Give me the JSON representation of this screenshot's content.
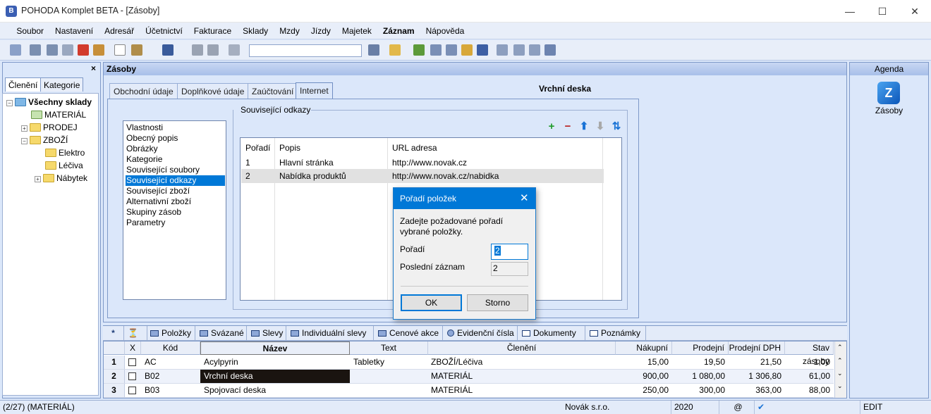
{
  "window": {
    "title": "POHODA Komplet BETA - [Zásoby]",
    "app_icon": "B",
    "minimize": "—",
    "maximize": "☐",
    "close": "✕"
  },
  "menu": [
    "Soubor",
    "Nastavení",
    "Adresář",
    "Účetnictví",
    "Fakturace",
    "Sklady",
    "Mzdy",
    "Jízdy",
    "Majetek",
    "Záznam",
    "Nápověda"
  ],
  "left_panel": {
    "tabs": [
      "Členění",
      "Kategorie"
    ],
    "close": "×",
    "tree": [
      {
        "label": "Všechny sklady",
        "level": 0,
        "bold": true,
        "expander": "−"
      },
      {
        "label": "MATERIÁL",
        "level": 1,
        "expander": ""
      },
      {
        "label": "PRODEJ",
        "level": 1,
        "expander": "+"
      },
      {
        "label": "ZBOŽÍ",
        "level": 1,
        "expander": "−"
      },
      {
        "label": "Elektro",
        "level": 2,
        "expander": ""
      },
      {
        "label": "Léčiva",
        "level": 2,
        "expander": ""
      },
      {
        "label": "Nábytek",
        "level": 2,
        "expander": "+"
      }
    ]
  },
  "center": {
    "header": "Zásoby",
    "tabs": [
      "Obchodní údaje",
      "Doplňkové údaje",
      "Zaúčtování",
      "Internet"
    ],
    "active_tab": "Internet",
    "record_title": "Vrchní deska"
  },
  "internet": {
    "list": [
      "Vlastnosti",
      "Obecný popis",
      "Obrázky",
      "Kategorie",
      "Související soubory",
      "Související odkazy",
      "Související zboží",
      "Alternativní zboží",
      "Skupiny zásob",
      "Parametry"
    ],
    "selected_index": 5,
    "group_title": "Související odkazy",
    "columns": [
      "Pořadí",
      "Popis",
      "URL adresa"
    ],
    "rows": [
      {
        "poradi": "1",
        "popis": "Hlavní stránka",
        "url": "http://www.novak.cz"
      },
      {
        "poradi": "2",
        "popis": "Nabídka produktů",
        "url": "http://www.novak.cz/nabidka"
      }
    ],
    "actions": {
      "add": "+",
      "remove": "−",
      "up": "⬆",
      "down": "⬇",
      "sort": "⇅"
    }
  },
  "dialog": {
    "title": "Pořadí položek",
    "close": "✕",
    "message": "Zadejte požadované pořadí vybrané položky.",
    "poradi_label": "Pořadí",
    "poradi_value": "2",
    "posledni_label": "Poslední záznam",
    "posledni_value": "2",
    "ok": "OK",
    "cancel": "Storno"
  },
  "right_panel": {
    "header": "Agenda",
    "item_label": "Zásoby",
    "icon_letter": "Z"
  },
  "bottom_tabs": [
    "Položky",
    "Svázané",
    "Slevy",
    "Individuální slevy",
    "Cenové akce",
    "Evidenční čísla",
    "Dokumenty",
    "Poznámky"
  ],
  "grid": {
    "columns": [
      "X",
      "Kód",
      "Název",
      "Text",
      "Členění",
      "Nákupní",
      "Prodejní",
      "Prodejní DPH",
      "Stav zásoby"
    ],
    "rows": [
      {
        "n": "1",
        "kod": "AC",
        "nazev": "Acylpyrin",
        "text": "Tabletky",
        "cleneni": "ZBOŽÍ/Léčiva",
        "nakupni": "15,00",
        "prodejni": "19,50",
        "dph": "21,50",
        "stav": "1,00"
      },
      {
        "n": "2",
        "kod": "B02",
        "nazev": "Vrchní deska",
        "text": "",
        "cleneni": "MATERIÁL",
        "nakupni": "900,00",
        "prodejni": "1 080,00",
        "dph": "1 306,80",
        "stav": "61,00"
      },
      {
        "n": "3",
        "kod": "B03",
        "nazev": "Spojovací deska",
        "text": "",
        "cleneni": "MATERIÁL",
        "nakupni": "250,00",
        "prodejni": "300,00",
        "dph": "363,00",
        "stav": "88,00"
      }
    ]
  },
  "status": {
    "record": "(2/27) (MATERIÁL)",
    "company": "Novák s.r.o.",
    "year": "2020",
    "at": "@",
    "mode": "EDIT"
  }
}
